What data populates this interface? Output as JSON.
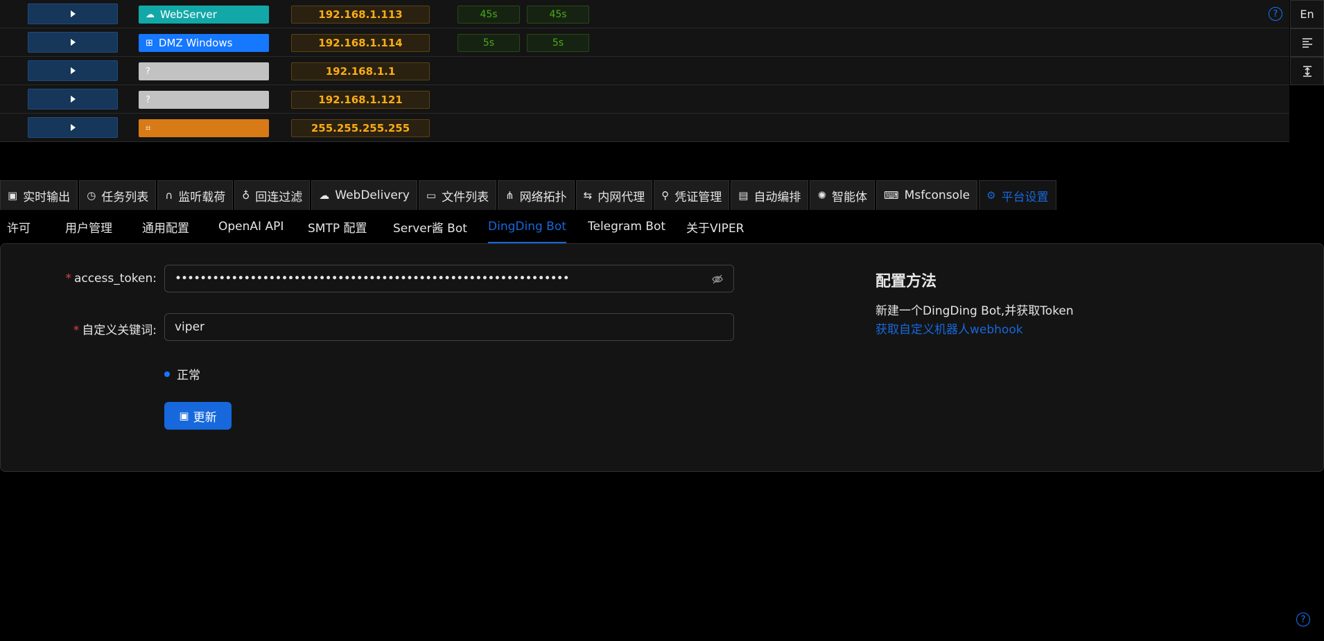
{
  "hosts": [
    {
      "os_icon": "cloud-icon",
      "os_label": "WebServer",
      "os_color": "#13a8a8",
      "ip": "192.168.1.113",
      "time1": "45s",
      "time2": "45s"
    },
    {
      "os_icon": "windows-icon",
      "os_label": "DMZ Windows",
      "os_color": "#1677ff",
      "ip": "192.168.1.114",
      "time1": "5s",
      "time2": "5s"
    },
    {
      "os_icon": "question-icon",
      "os_label": "",
      "os_color": "#c2c2c2",
      "ip": "192.168.1.1"
    },
    {
      "os_icon": "question-icon",
      "os_label": "",
      "os_color": "#c2c2c2",
      "ip": "192.168.1.121"
    },
    {
      "os_icon": "router-icon",
      "os_label": "",
      "os_color": "#d87a16",
      "ip": "255.255.255.255"
    }
  ],
  "right_toolbar": {
    "lang_label": "En",
    "icons": [
      "align-left-icon",
      "vertical-align-icon"
    ]
  },
  "main_tabs": [
    {
      "icon": "monitor-icon",
      "label": "实时输出"
    },
    {
      "icon": "clock-icon",
      "label": "任务列表"
    },
    {
      "icon": "headphones-icon",
      "label": "监听载荷"
    },
    {
      "icon": "fire-icon",
      "label": "回连过滤"
    },
    {
      "icon": "cloud-download-icon",
      "label": "WebDelivery"
    },
    {
      "icon": "folder-open-icon",
      "label": "文件列表"
    },
    {
      "icon": "topology-icon",
      "label": "网络拓扑"
    },
    {
      "icon": "proxy-icon",
      "label": "内网代理"
    },
    {
      "icon": "key-icon",
      "label": "凭证管理"
    },
    {
      "icon": "robot-icon",
      "label": "自动编排"
    },
    {
      "icon": "openai-icon",
      "label": "智能体"
    },
    {
      "icon": "code-icon",
      "label": "Msfconsole"
    },
    {
      "icon": "gear-icon",
      "label": "平台设置",
      "active": true
    }
  ],
  "sub_tabs": [
    {
      "label": "许可"
    },
    {
      "label": "用户管理"
    },
    {
      "label": "通用配置"
    },
    {
      "label": "OpenAI API"
    },
    {
      "label": "SMTP 配置"
    },
    {
      "label": "Server酱 Bot"
    },
    {
      "label": "DingDing Bot",
      "active": true
    },
    {
      "label": "Telegram Bot"
    },
    {
      "label": "关于VIPER"
    }
  ],
  "form": {
    "access_token_label": "access_token",
    "access_token_masked": "•••••••••••••••••••••••••••••••••••••••••••••••••••••••••••••••",
    "keyword_label": "自定义关键词",
    "keyword_value": "viper",
    "status_text": "正常",
    "update_label": "更新"
  },
  "config_help": {
    "title": "配置方法",
    "description": "新建一个DingDing Bot,并获取Token",
    "link_text": "获取自定义机器人webhook"
  },
  "colors": {
    "accent": "#1668dc",
    "ip_text": "#faad14",
    "time_text": "#49aa19"
  }
}
